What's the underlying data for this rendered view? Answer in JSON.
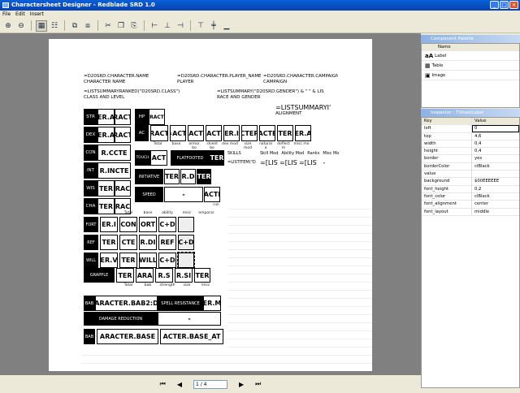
{
  "window": {
    "title": "Charactersheet Designer - Redblade SRD 1.0",
    "minimize": "_",
    "maximize": "□",
    "close": "×"
  },
  "menu": [
    "File",
    "Edit",
    "Insert"
  ],
  "toolbar": {
    "icons": [
      "zoom-in",
      "zoom-out",
      "grid",
      "snap",
      "front",
      "back",
      "cut",
      "copy",
      "paste",
      "align-left",
      "align-center",
      "align-right",
      "align-top",
      "align-middle",
      "align-bottom"
    ]
  },
  "sheet": {
    "name_field": "=D20SRD.CHARACTER.NAME",
    "name_label": "CHARACTER NAME",
    "player_field": "=D20SRD.CHARACTER.PLAYER_NAME",
    "player_label": "PLAYER",
    "campaign_field": "=D20SRD.CHARACTER.CAMPAIGN",
    "campaign_label": "CAMPAIGN",
    "class_field": "=LISTSUMMARYRANKED(\"D20SRD.CLASS\")",
    "class_label": "CLASS AND LEVEL",
    "race_field": "=LISTSUMMARY(\"D20SRD.GENDER\") & \" \" & LIS",
    "race_label": "RACE AND GENDER",
    "alignment_field": "=LISTSUMMARYI'",
    "alignment_label": "ALIGNMENT",
    "abilities": [
      {
        "name": "STR",
        "score": "ER.A",
        "mod": "RACT"
      },
      {
        "name": "DEX",
        "score": "ER.A",
        "mod": "RACT"
      },
      {
        "name": "CON",
        "score": "R.CCTE",
        "mod": ""
      },
      {
        "name": "INT",
        "score": "R.INCTE",
        "mod": ""
      },
      {
        "name": "WIS",
        "score": "TER",
        "mod": "RAC"
      },
      {
        "name": "CHA",
        "score": "TER",
        "mod": "RAC"
      }
    ],
    "hp_label": "HP",
    "hp_value": "RACT",
    "ac_label": "AC",
    "ac_value": "RACT",
    "ac_parts": [
      "=ACTI",
      "ACT",
      "ACT",
      "ER.I",
      "CTER",
      "ACTE",
      "TER",
      "ER.A"
    ],
    "ac_labels": [
      "Total",
      "base",
      "armor bo",
      "shield bo",
      "dex mod",
      "size mod",
      "natural a",
      "deflect m",
      "misc mo"
    ],
    "touch_label": "TOUCH",
    "touch_value": "ACT",
    "flatfooted_label": "FLATFOOTED",
    "flatfooted_value": "TER",
    "initiative_label": "INITIATIVE",
    "initiative_values": [
      "TER",
      "R.D",
      "TER"
    ],
    "speed_label": "SPEED",
    "speed_value": "-",
    "speed_extra": "ACTI",
    "speed_run": "run",
    "skills_header": [
      "SKILLS",
      "Skill Mod",
      "Ability Mod",
      "Ranks",
      "Misc Mo"
    ],
    "skills_row": [
      "=LISTITEM(\"D",
      "=[LIST",
      "=[LIST",
      "=[LIST",
      "-"
    ],
    "saves_header": [
      "Total",
      "base",
      "ability",
      "misc",
      "emporar"
    ],
    "saves": [
      {
        "name": "FORT",
        "vals": [
          "ER.I",
          "CON",
          "ORT",
          "C+D",
          ""
        ]
      },
      {
        "name": "REF",
        "vals": [
          "TER",
          "CTE",
          "R.DI",
          "REF",
          "C+D"
        ]
      },
      {
        "name": "WILL",
        "vals": [
          "ER.V",
          "TER",
          "WILL",
          "C+D",
          ""
        ]
      }
    ],
    "grapple_label": "GRAPPLE",
    "grapple_vals": [
      "TER",
      "ARA",
      "R.S",
      "R.SI",
      "TER"
    ],
    "grapple_labels": [
      "Total",
      "bab",
      "strength",
      "size",
      "misc"
    ],
    "bab_label": "BAB",
    "bab_value": "ARACTER.BAB2:D",
    "spell_res_label": "SPELL RESISTANCE",
    "spell_res_value": "ER.M",
    "damage_red_label": "DAMAGE REDUCTION",
    "damage_red_value": "-",
    "bab2_label": "BAB",
    "bab2_value1": "ARACTER.BASE",
    "bab2_value2": "ACTER.BASE_AT"
  },
  "nav": {
    "first": "⏮",
    "prev": "◀",
    "page": "1 / 4",
    "next": "▶",
    "last": "⏭"
  },
  "palette": {
    "title": "Component Palette",
    "header": "Name",
    "items": [
      "Label",
      "Table",
      "Image"
    ]
  },
  "inspector": {
    "title": "Inspector : TSheetLabel",
    "header": [
      "Key",
      "Value"
    ],
    "rows": [
      [
        "left",
        "0"
      ],
      [
        "top",
        "4,6"
      ],
      [
        "width",
        "0,4"
      ],
      [
        "height",
        "0,4"
      ],
      [
        "border",
        "yes"
      ],
      [
        "borderColor",
        "clBlack"
      ],
      [
        "value",
        ""
      ],
      [
        "background",
        "$00EEEEEE"
      ],
      [
        "font_height",
        "0,2"
      ],
      [
        "font_color",
        "clBlack"
      ],
      [
        "font_alignment",
        "center"
      ],
      [
        "font_layout",
        "middle"
      ]
    ]
  }
}
